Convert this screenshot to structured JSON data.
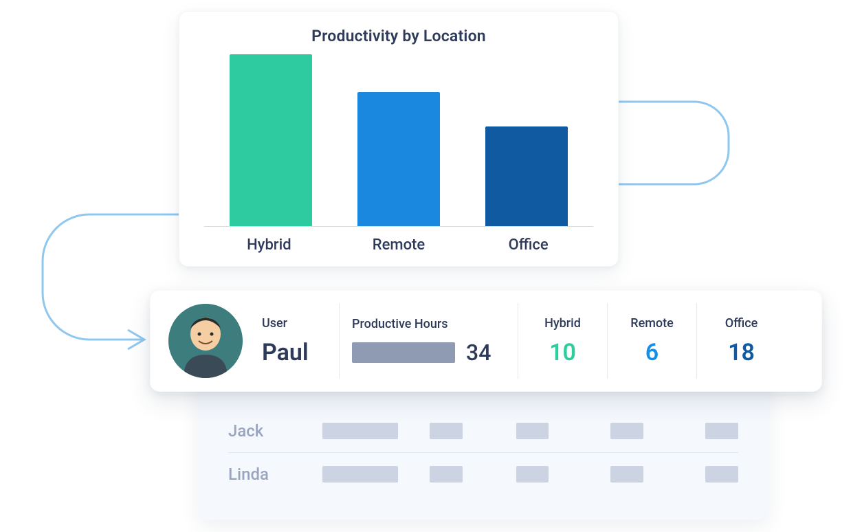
{
  "chart_data": {
    "type": "bar",
    "title": "Productivity by Location",
    "categories": [
      "Hybrid",
      "Remote",
      "Office"
    ],
    "values": [
      100,
      78,
      58
    ],
    "colors": [
      "#2fcba0",
      "#1b88df",
      "#0f5aa0"
    ],
    "xlabel": "",
    "ylabel": "",
    "ylim": [
      0,
      100
    ]
  },
  "user_row": {
    "headers": {
      "user": "User",
      "productive_hours": "Productive Hours",
      "hybrid": "Hybrid",
      "remote": "Remote",
      "office": "Office"
    },
    "name": "Paul",
    "productive_hours": 34,
    "hybrid": 10,
    "remote": 6,
    "office": 18
  },
  "list_rows": [
    {
      "name": "Jack"
    },
    {
      "name": "Linda"
    }
  ]
}
